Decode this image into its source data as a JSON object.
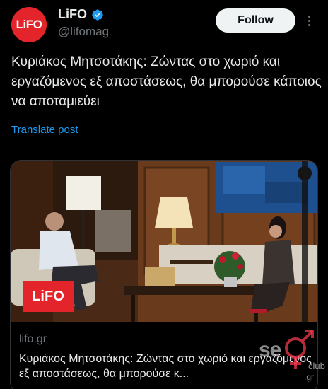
{
  "account": {
    "avatar_text": "LiFO",
    "display_name": "LiFO",
    "handle": "@lifomag",
    "verified_icon": "verified-badge-icon",
    "follow_label": "Follow",
    "more_icon": "more-options-icon"
  },
  "post": {
    "text": "Κυριάκος Μητσοτάκης: Ζώντας στο χωριό και εργαζόμενος εξ αποστάσεως, θα μπορούσε κάποιος να αποταμιεύει",
    "translate_label": "Translate post"
  },
  "link_card": {
    "image_logo_text": "LiFO",
    "domain": "lifo.gr",
    "title": "Κυριάκος Μητσοτάκης: Ζώντας στο χωριό και εργαζόμενος εξ αποστάσεως, θα μπορούσε κ..."
  },
  "watermark": {
    "se": "se",
    "club": "club",
    "gr": ".gr"
  },
  "colors": {
    "background": "#000000",
    "text": "#e7e9ea",
    "secondary": "#71767b",
    "link": "#1d9bf0",
    "brand_red": "#e3252b",
    "follow_bg": "#eff3f4"
  }
}
